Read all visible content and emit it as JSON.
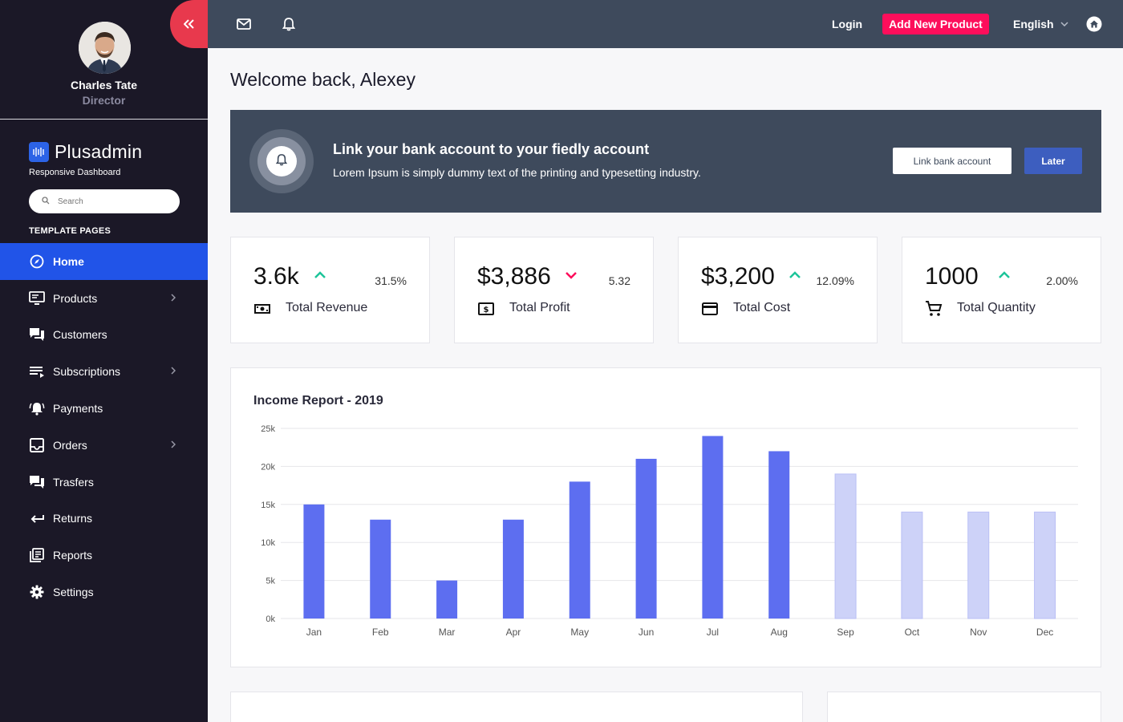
{
  "sidebar": {
    "profile": {
      "name": "Charles Tate",
      "role": "Director"
    },
    "brand": {
      "name": "Plusadmin",
      "subtitle": "Responsive Dashboard"
    },
    "search": {
      "placeholder": "Search"
    },
    "section_label": "TEMPLATE PAGES",
    "items": [
      {
        "label": "Home",
        "icon": "compass-icon",
        "active": true,
        "chevron": false
      },
      {
        "label": "Products",
        "icon": "monitor-icon",
        "chevron": true
      },
      {
        "label": "Customers",
        "icon": "chat-icon",
        "chevron": false
      },
      {
        "label": "Subscriptions",
        "icon": "list-icon",
        "chevron": true
      },
      {
        "label": "Payments",
        "icon": "bell-ring-icon",
        "chevron": false
      },
      {
        "label": "Orders",
        "icon": "inbox-icon",
        "chevron": true
      },
      {
        "label": "Trasfers",
        "icon": "chat-icon",
        "chevron": false
      },
      {
        "label": "Returns",
        "icon": "return-arrow-icon",
        "chevron": false
      },
      {
        "label": "Reports",
        "icon": "reports-icon",
        "chevron": false
      },
      {
        "label": "Settings",
        "icon": "gear-icon",
        "chevron": false
      }
    ]
  },
  "topbar": {
    "login": "Login",
    "add_product": "Add New Product",
    "language": "English"
  },
  "main": {
    "welcome": "Welcome back, Alexey",
    "banner": {
      "title": "Link your bank account to your fiedly account",
      "text": "Lorem Ipsum is simply dummy text of the printing and typesetting industry.",
      "link_button": "Link bank account",
      "later_button": "Later"
    },
    "stats": [
      {
        "value": "3.6k",
        "trend": "up",
        "change": "31.5%",
        "label": "Total Revenue",
        "icon": "money-icon"
      },
      {
        "value": "$3,886",
        "trend": "down",
        "change": "5.32",
        "label": "Total Profit",
        "icon": "dollar-bill-icon"
      },
      {
        "value": "$3,200",
        "trend": "up",
        "change": "12.09%",
        "label": "Total Cost",
        "icon": "credit-card-icon"
      },
      {
        "value": "1000",
        "trend": "up",
        "change": "2.00%",
        "label": "Total Quantity",
        "icon": "cart-icon"
      }
    ]
  },
  "colors": {
    "accent": "#2154e8",
    "bar_primary": "#5d6ef0",
    "bar_light": "#cdd2f8",
    "trend_up": "#1dc49a",
    "trend_down": "#fd0e5b"
  },
  "chart_data": {
    "type": "bar",
    "title": "Income Report - 2019",
    "categories": [
      "Jan",
      "Feb",
      "Mar",
      "Apr",
      "May",
      "Jun",
      "Jul",
      "Aug",
      "Sep",
      "Oct",
      "Nov",
      "Dec"
    ],
    "values": [
      15000,
      13000,
      5000,
      13000,
      18000,
      21000,
      24000,
      22000,
      19000,
      14000,
      14000,
      14000
    ],
    "highlighted": [
      true,
      true,
      true,
      true,
      true,
      true,
      true,
      true,
      false,
      false,
      false,
      false
    ],
    "yticks": [
      "0k",
      "5k",
      "10k",
      "15k",
      "20k",
      "25k"
    ],
    "ylim": [
      0,
      25000
    ],
    "grid": true,
    "xlabel": "",
    "ylabel": ""
  }
}
